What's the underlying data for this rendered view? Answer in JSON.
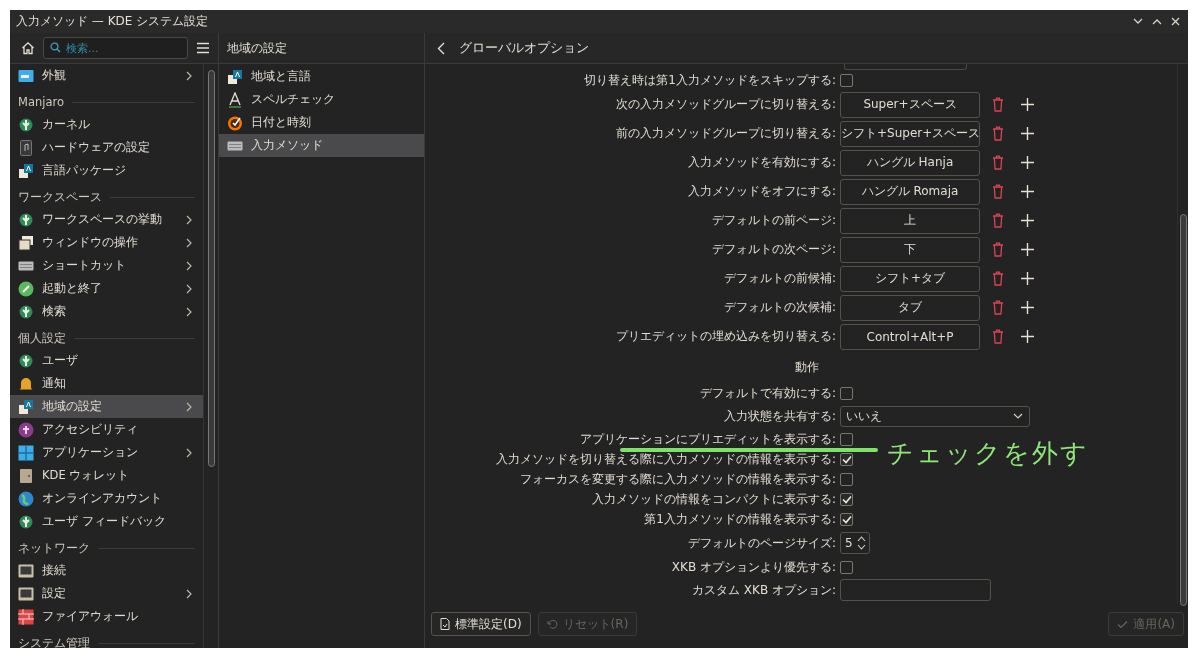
{
  "window": {
    "title": "入力メソッド — KDE システム設定"
  },
  "sidebar": {
    "search": {
      "placeholder": "検索..."
    },
    "items": [
      {
        "kind": "item",
        "label": "外観",
        "has_children": true,
        "selected": false
      },
      {
        "kind": "section",
        "label": "Manjaro"
      },
      {
        "kind": "item",
        "label": "カーネル",
        "has_children": false,
        "selected": false
      },
      {
        "kind": "item",
        "label": "ハードウェアの設定",
        "has_children": false,
        "selected": false
      },
      {
        "kind": "item",
        "label": "言語パッケージ",
        "has_children": false,
        "selected": false
      },
      {
        "kind": "section",
        "label": "ワークスペース"
      },
      {
        "kind": "item",
        "label": "ワークスペースの挙動",
        "has_children": true,
        "selected": false
      },
      {
        "kind": "item",
        "label": "ウィンドウの操作",
        "has_children": true,
        "selected": false
      },
      {
        "kind": "item",
        "label": "ショートカット",
        "has_children": true,
        "selected": false
      },
      {
        "kind": "item",
        "label": "起動と終了",
        "has_children": true,
        "selected": false
      },
      {
        "kind": "item",
        "label": "検索",
        "has_children": true,
        "selected": false
      },
      {
        "kind": "section",
        "label": "個人設定"
      },
      {
        "kind": "item",
        "label": "ユーザ",
        "has_children": false,
        "selected": false
      },
      {
        "kind": "item",
        "label": "通知",
        "has_children": false,
        "selected": false
      },
      {
        "kind": "item",
        "label": "地域の設定",
        "has_children": true,
        "selected": true
      },
      {
        "kind": "item",
        "label": "アクセシビリティ",
        "has_children": false,
        "selected": false
      },
      {
        "kind": "item",
        "label": "アプリケーション",
        "has_children": true,
        "selected": false
      },
      {
        "kind": "item",
        "label": "KDE ウォレット",
        "has_children": false,
        "selected": false
      },
      {
        "kind": "item",
        "label": "オンラインアカウント",
        "has_children": false,
        "selected": false
      },
      {
        "kind": "item",
        "label": "ユーザ フィードバック",
        "has_children": false,
        "selected": false
      },
      {
        "kind": "section",
        "label": "ネットワーク"
      },
      {
        "kind": "item",
        "label": "接続",
        "has_children": false,
        "selected": false
      },
      {
        "kind": "item",
        "label": "設定",
        "has_children": true,
        "selected": false
      },
      {
        "kind": "item",
        "label": "ファイアウォール",
        "has_children": false,
        "selected": false
      },
      {
        "kind": "section",
        "label": "システム管理"
      }
    ]
  },
  "subpanel": {
    "title": "地域の設定",
    "items": [
      {
        "label": "地域と言語",
        "selected": false
      },
      {
        "label": "スペルチェック",
        "selected": false
      },
      {
        "label": "日付と時刻",
        "selected": false
      },
      {
        "label": "入力メソッド",
        "selected": true
      }
    ]
  },
  "page": {
    "title": "グローバルオプション",
    "rows": [
      {
        "kind": "checkbox",
        "label": "切り替え時は第1入力メソッドをスキップする:",
        "checked": false
      },
      {
        "kind": "shortcut",
        "label": "次の入力メソッドグループに切り替える:",
        "value": "Super+スペース"
      },
      {
        "kind": "shortcut",
        "label": "前の入力メソッドグループに切り替える:",
        "value": "シフト+Super+スペース"
      },
      {
        "kind": "shortcut",
        "label": "入力メソッドを有効にする:",
        "value": "ハングル Hanja"
      },
      {
        "kind": "shortcut",
        "label": "入力メソッドをオフにする:",
        "value": "ハングル Romaja"
      },
      {
        "kind": "shortcut",
        "label": "デフォルトの前ページ:",
        "value": "上"
      },
      {
        "kind": "shortcut",
        "label": "デフォルトの次ページ:",
        "value": "下"
      },
      {
        "kind": "shortcut",
        "label": "デフォルトの前候補:",
        "value": "シフト+タブ"
      },
      {
        "kind": "shortcut",
        "label": "デフォルトの次候補:",
        "value": "タブ"
      },
      {
        "kind": "shortcut",
        "label": "プリエディットの埋め込みを切り替える:",
        "value": "Control+Alt+P"
      },
      {
        "kind": "heading",
        "label": "動作"
      },
      {
        "kind": "checkbox",
        "label": "デフォルトで有効にする:",
        "checked": false
      },
      {
        "kind": "select",
        "label": "入力状態を共有する:",
        "value": "いいえ"
      },
      {
        "kind": "checkbox",
        "label": "アプリケーションにプリエディットを表示する:",
        "checked": false
      },
      {
        "kind": "checkbox",
        "label": "入力メソッドを切り替える際に入力メソッドの情報を表示する:",
        "checked": true
      },
      {
        "kind": "checkbox",
        "label": "フォーカスを変更する際に入力メソッドの情報を表示する:",
        "checked": false
      },
      {
        "kind": "checkbox",
        "label": "入力メソッドの情報をコンパクトに表示する:",
        "checked": true
      },
      {
        "kind": "checkbox",
        "label": "第1入力メソッドの情報を表示する:",
        "checked": true
      },
      {
        "kind": "spin",
        "label": "デフォルトのページサイズ:",
        "value": "5"
      },
      {
        "kind": "checkbox",
        "label": "XKB オプションより優先する:",
        "checked": false
      },
      {
        "kind": "text",
        "label": "カスタム XKB オプション:",
        "value": ""
      }
    ]
  },
  "footer": {
    "buttons": [
      {
        "label": "標準設定(D)",
        "kind": "defaults",
        "disabled": false
      },
      {
        "label": "リセット(R)",
        "kind": "reset",
        "disabled": true
      },
      {
        "label": "適用(A)",
        "kind": "apply",
        "disabled": true
      }
    ]
  },
  "annotation": {
    "text": "チェックを外す"
  }
}
